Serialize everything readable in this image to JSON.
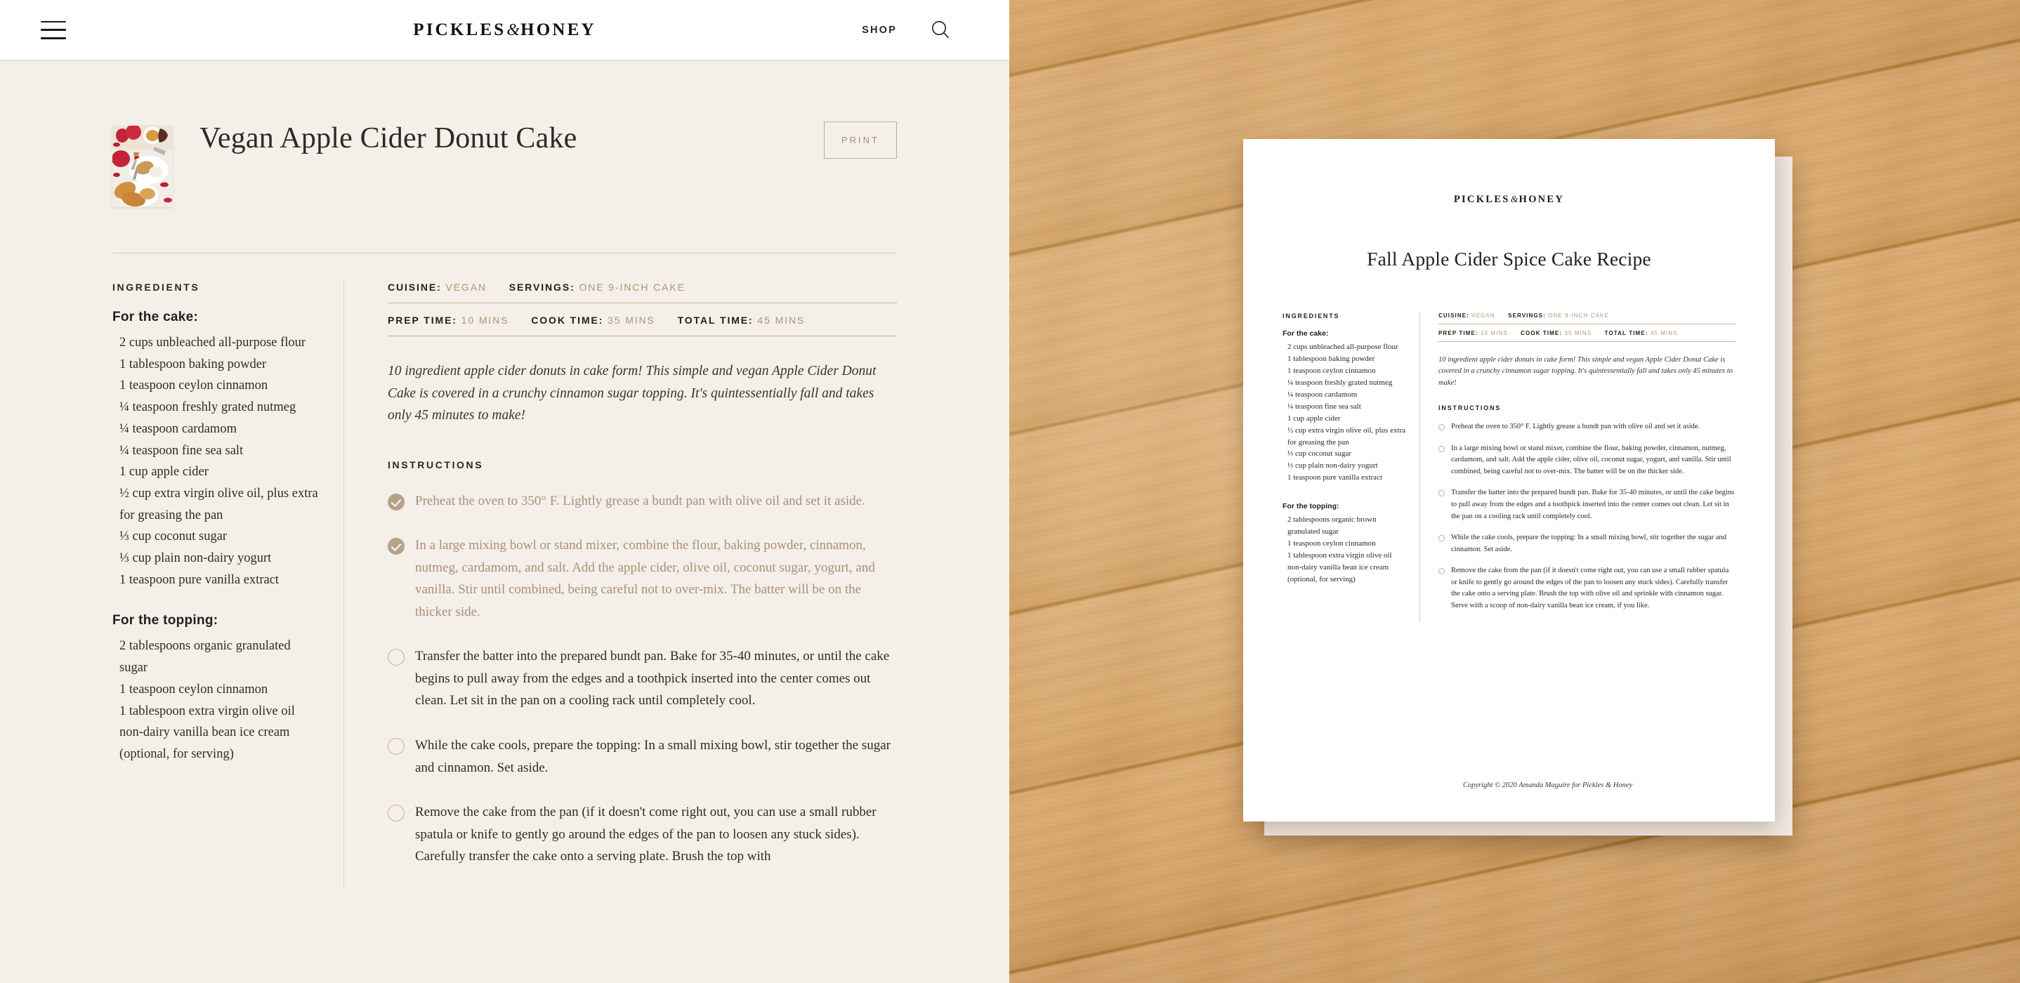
{
  "header": {
    "menu_icon": "hamburger-menu-icon",
    "brand_part1": "PICKLES",
    "brand_amp": "&",
    "brand_part2": "HONEY",
    "shop_label": "SHOP",
    "search_icon": "search-icon"
  },
  "recipe": {
    "title": "Vegan Apple Cider Donut Cake",
    "print_label": "PRINT",
    "ingredients_label": "INGREDIENTS",
    "cake_group_label": "For the cake:",
    "cake_ingredients": [
      "2 cups unbleached all-purpose flour",
      "1 tablespoon baking powder",
      "1 teaspoon ceylon cinnamon",
      "¼ teaspoon freshly grated nutmeg",
      "¼ teaspoon cardamom",
      "¼ teaspoon fine sea salt",
      "1 cup apple cider",
      "½ cup extra virgin olive oil, plus extra for greasing the pan",
      "⅓ cup coconut sugar",
      "⅓ cup plain non-dairy yogurt",
      "1 teaspoon pure vanilla extract"
    ],
    "topping_group_label": "For the topping:",
    "topping_ingredients": [
      "2 tablespoons organic granulated sugar",
      "1 teaspoon ceylon cinnamon",
      "1 tablespoon extra virgin olive oil",
      "non-dairy vanilla bean ice cream (optional, for serving)"
    ],
    "meta": {
      "cuisine_key": "CUISINE:",
      "cuisine_value": "VEGAN",
      "servings_key": "SERVINGS:",
      "servings_value": "ONE 9-INCH CAKE",
      "prep_key": "PREP TIME:",
      "prep_value": "10 MINS",
      "cook_key": "COOK TIME:",
      "cook_value": "35 MINS",
      "total_key": "TOTAL TIME:",
      "total_value": "45 MINS"
    },
    "description": "10 ingredient apple cider donuts in cake form! This simple and vegan Apple Cider Donut Cake is covered in a crunchy cinnamon sugar topping. It's quintessentially fall and takes only 45 minutes to make!",
    "instructions_label": "INSTRUCTIONS",
    "steps": [
      {
        "done": true,
        "text": "Preheat the oven to 350° F. Lightly grease a bundt pan with olive oil and set it aside."
      },
      {
        "done": true,
        "text": "In a large mixing bowl or stand mixer, combine the flour, baking powder, cinnamon, nutmeg, cardamom, and salt. Add the apple cider, olive oil, coconut sugar, yogurt, and vanilla. Stir until combined, being careful not to over-mix. The batter will be on the thicker side."
      },
      {
        "done": false,
        "text": "Transfer the batter into the prepared bundt pan. Bake for 35-40 minutes, or until the cake begins to pull away from the edges and a toothpick inserted into the center comes out clean. Let sit in the pan on a cooling rack until completely cool."
      },
      {
        "done": false,
        "text": "While the cake cools, prepare the topping: In a small mixing bowl, stir together the sugar and cinnamon. Set aside."
      },
      {
        "done": false,
        "text": "Remove the cake from the pan (if it doesn't come right out, you can use a small rubber spatula or knife to gently go around the edges of the pan to loosen any stuck sides). Carefully transfer the cake onto a serving plate. Brush the top with"
      }
    ]
  },
  "printed_page": {
    "brand_part1": "PICKLES",
    "brand_amp": "&",
    "brand_part2": "HONEY",
    "title": "Fall Apple Cider Spice Cake Recipe",
    "ingredients_label": "INGREDIENTS",
    "cake_group_label": "For the cake:",
    "cake_ingredients": [
      "2 cups unbleached all-purpose flour",
      "1 tablespoon baking powder",
      "1 teaspoon ceylon cinnamon",
      "¼ teaspoon freshly grated nutmeg",
      "¼ teaspoon cardamom",
      "¼ teaspoon fine sea salt",
      "1 cup apple cider",
      "½ cup extra virgin olive oil, plus extra for greasing the pan",
      "⅓ cup coconut sugar",
      "⅓ cup plain non-dairy yogurt",
      "1 teaspoon pure vanilla extract"
    ],
    "topping_group_label": "For the topping:",
    "topping_ingredients": [
      "2 tablespoons organic brown granulated sugar",
      "1 teaspoon ceylon cinnamon",
      "1 tablespoon extra virgin olive oil",
      "non-dairy vanilla bean ice cream (optional, for serving)"
    ],
    "meta": {
      "cuisine_key": "CUISINE:",
      "cuisine_value": "VEGAN",
      "servings_key": "SERVINGS:",
      "servings_value": "ONE 9-INCH CAKE",
      "prep_key": "PREP TIME:",
      "prep_value": "10 MINS",
      "cook_key": "COOK TIME:",
      "cook_value": "35 MINS",
      "total_key": "TOTAL TIME:",
      "total_value": "45 MINS"
    },
    "description": "10 ingredient apple cider donuts in cake form! This simple and vegan Apple Cider Donut Cake is covered in a crunchy cinnamon sugar topping. It's quintessentially fall and takes only 45 minutes to make!",
    "instructions_label": "INSTRUCTIONS",
    "steps": [
      "Preheat the oven to 350° F. Lightly grease a bundt pan with olive oil and set it aside.",
      "In a large mixing bowl or stand mixer, combine the flour, baking powder, cinnamon, nutmeg, cardamom, and salt. Add the apple cider, olive oil, coconut sugar, yogurt, and vanilla. Stir until combined, being careful not to over-mix. The batter will be on the thicker side.",
      "Transfer the batter into the prepared bundt pan. Bake for 35-40 minutes, or until the cake begins to pull away from the edges and a toothpick inserted into the center comes out clean. Let sit in the pan on a cooling rack until completely cool.",
      "While the cake cools, prepare the topping: In a small mixing bowl, stir together the sugar and cinnamon. Set aside.",
      "Remove the cake from the pan (if it doesn't come right out, you can use a small rubber spatula or knife to gently go around the edges of the pan to loosen any stuck sides). Carefully transfer the cake onto a serving plate. Brush the top with olive oil and sprinkle with cinnamon sugar. Serve with a scoop of non-dairy vanilla bean ice cream, if you like."
    ],
    "copyright": "Copyright © 2020 Amanda Maguire for Pickles & Honey"
  },
  "colors": {
    "page_bg": "#f5efe9",
    "accent_tan": "#b09372",
    "rule": "#d8c8b3",
    "wood": "#d2a067",
    "text": "#2f2b27"
  }
}
